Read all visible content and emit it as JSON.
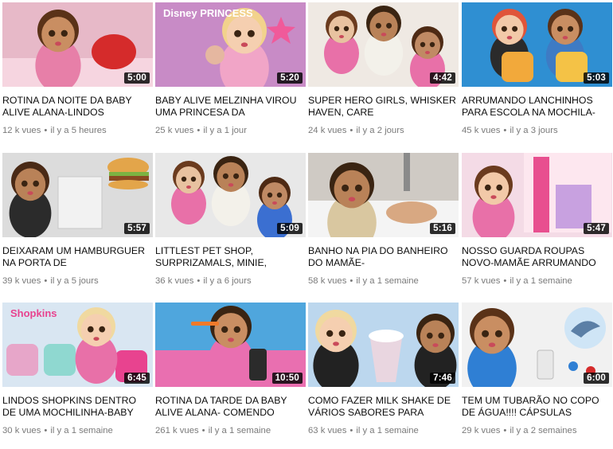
{
  "videos": [
    {
      "title": "ROTINA DA NOITE DA BABY ALIVE ALANA-LINDOS",
      "duration": "5:00",
      "views": "12 k vues",
      "age": "il y a 5 heures",
      "thumb_bg": "#e7b9c8",
      "thumb_accent": "#d52b2b",
      "thumb_icon": "doll-with-toy-icon"
    },
    {
      "title": "BABY ALIVE MELZINHA VIROU UMA PRINCESA DA",
      "duration": "5:20",
      "views": "25 k vues",
      "age": "il y a 1 jour",
      "thumb_bg": "#c88bc6",
      "thumb_accent": "#f05a9a",
      "thumb_icon": "disney-princess-logo-icon",
      "thumb_text": "Disney PRINCESS"
    },
    {
      "title": "SUPER HERO GIRLS, WHISKER HAVEN, CARE",
      "duration": "4:42",
      "views": "24 k vues",
      "age": "il y a 2 jours",
      "thumb_bg": "#efe9e3",
      "thumb_accent": "#e870a8",
      "thumb_icon": "three-dolls-icon"
    },
    {
      "title": "ARRUMANDO LANCHINHOS PARA ESCOLA NA MOCHILA-",
      "duration": "5:03",
      "views": "45 k vues",
      "age": "il y a 3 jours",
      "thumb_bg": "#2f8fd2",
      "thumb_accent": "#f2a93b",
      "thumb_icon": "backpack-icon"
    },
    {
      "title": "DEIXARAM UM HAMBURGUER NA PORTA DE",
      "duration": "5:57",
      "views": "39 k vues",
      "age": "il y a 5 jours",
      "thumb_bg": "#dcdcdc",
      "thumb_accent": "#7cb342",
      "thumb_icon": "hamburger-icon"
    },
    {
      "title": "LITTLEST PET SHOP, SURPRIZAMALS, MINIE,",
      "duration": "5:09",
      "views": "36 k vues",
      "age": "il y a 6 jours",
      "thumb_bg": "#e8e8e8",
      "thumb_accent": "#3b6fd1",
      "thumb_icon": "three-dolls-icon"
    },
    {
      "title": "BANHO NA PIA DO BANHEIRO DO MAMÃE-",
      "duration": "5:16",
      "views": "58 k vues",
      "age": "il y a 1 semaine",
      "thumb_bg": "#cfcac4",
      "thumb_accent": "#e7d34a",
      "thumb_icon": "sink-faucet-icon"
    },
    {
      "title": "NOSSO GUARDA ROUPAS NOVO-MAMÃE ARRUMANDO",
      "duration": "5:47",
      "views": "57 k vues",
      "age": "il y a 1 semaine",
      "thumb_bg": "#f4dbe6",
      "thumb_accent": "#e84f8f",
      "thumb_icon": "wardrobe-icon"
    },
    {
      "title": "LINDOS SHOPKINS DENTRO DE UMA MOCHILINHA-BABY",
      "duration": "6:45",
      "views": "30 k vues",
      "age": "il y a 1 semaine",
      "thumb_bg": "#d9e6f2",
      "thumb_accent": "#e8438f",
      "thumb_icon": "shopkins-logo-icon",
      "thumb_text": "Shopkins"
    },
    {
      "title": "ROTINA DA TARDE DA BABY ALIVE ALANA- COMENDO",
      "duration": "10:50",
      "views": "261 k vues",
      "age": "il y a 1 semaine",
      "thumb_bg": "#4fa6dd",
      "thumb_accent": "#e96fb0",
      "thumb_icon": "feeding-spoon-icon"
    },
    {
      "title": "COMO FAZER MILK SHAKE DE VÁRIOS SABORES PARA",
      "duration": "7:46",
      "views": "63 k vues",
      "age": "il y a 1 semaine",
      "thumb_bg": "#bcd7ee",
      "thumb_accent": "#c9352e",
      "thumb_icon": "milkshake-icon"
    },
    {
      "title": "TEM UM TUBARÃO NO COPO DE ÁGUA!!!! CÁPSULAS",
      "duration": "6:00",
      "views": "29 k vues",
      "age": "il y a 2 semaines",
      "thumb_bg": "#f1f1f1",
      "thumb_accent": "#2f7fd4",
      "thumb_icon": "shark-icon"
    }
  ],
  "meta_separator": "•"
}
